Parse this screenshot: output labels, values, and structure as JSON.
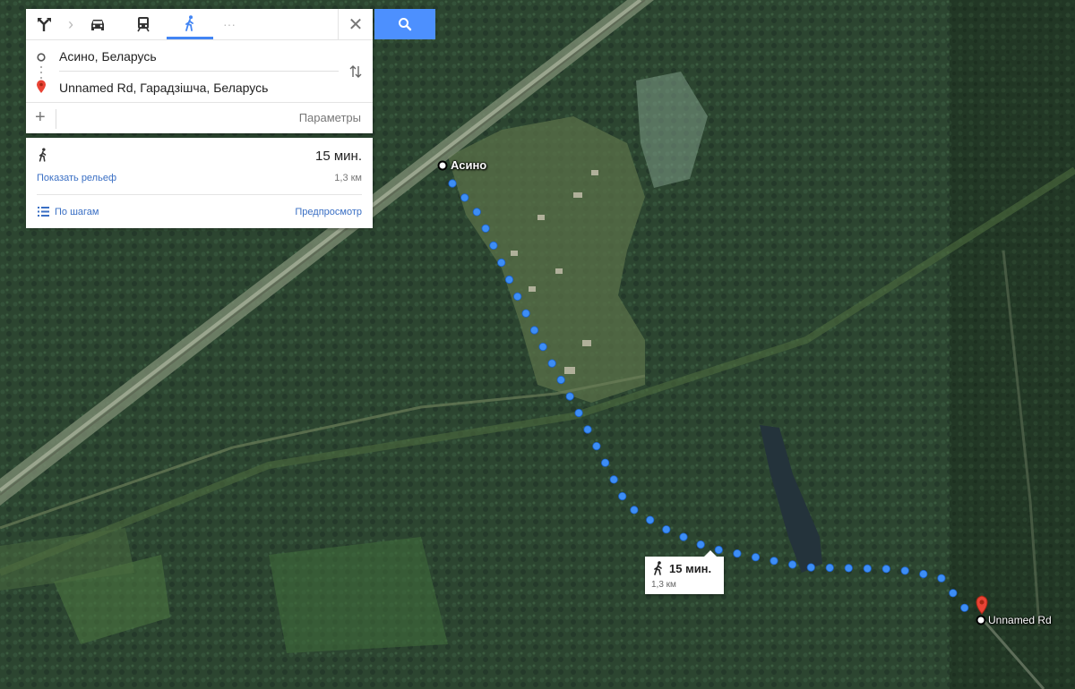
{
  "modes": {
    "directions_icon": "directions-icon",
    "driving_icon": "car-icon",
    "transit_icon": "train-icon",
    "walking_icon": "walking-icon",
    "more_label": "···",
    "active_color": "#4285f4"
  },
  "search": {
    "origin": "Асино, Беларусь",
    "destination": "Unnamed Rd, Гарадзішча, Беларусь",
    "add_label": "+",
    "options_label": "Параметры",
    "close_label": "✕"
  },
  "route": {
    "time": "15 мин.",
    "distance": "1,3 км",
    "show_terrain": "Показать рельеф",
    "steps": "По шагам",
    "preview": "Предпросмотр"
  },
  "map": {
    "origin_label": "Асино",
    "destination_label": "Unnamed Rd",
    "callout_time": "15 мин.",
    "callout_distance": "1,3 км",
    "route_color": "#3d8ef5",
    "marker_color": "#e94335"
  }
}
